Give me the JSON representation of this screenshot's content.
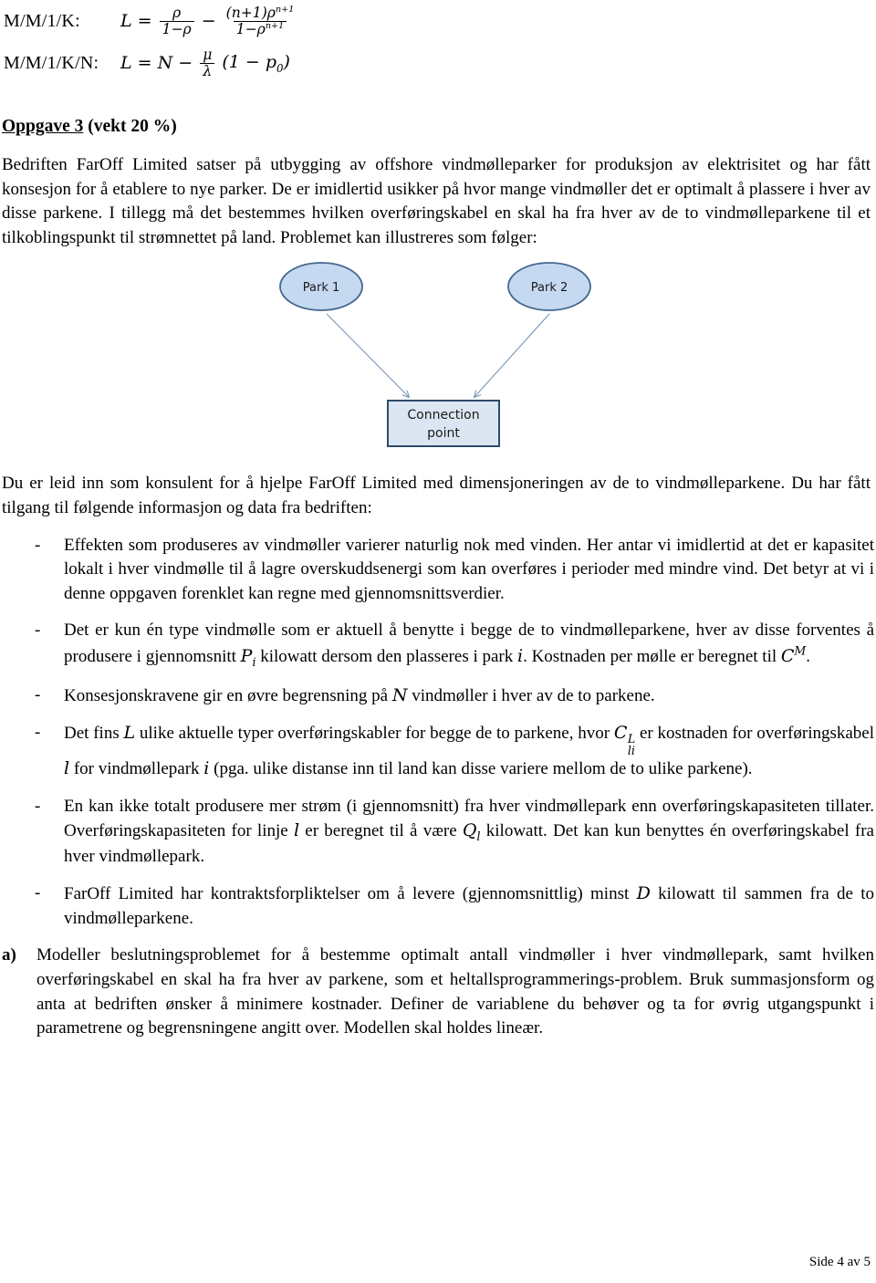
{
  "formulas": [
    {
      "label": "M/M/1/K:",
      "lhs": "L =",
      "term1_num": "ρ",
      "term1_den": "1−ρ",
      "operator": "−",
      "term2_num_a": "(n+1)ρ",
      "term2_num_sup": "n+1",
      "term2_den_a": "1−ρ",
      "term2_den_sup": "n+1"
    },
    {
      "label": "M/M/1/K/N:",
      "lhs": "L = N −",
      "frac_num": "μ",
      "frac_den": "λ",
      "tail_open": "(1 − p",
      "tail_sub": "0",
      "tail_close": ")"
    }
  ],
  "heading": {
    "title": "Oppgave 3",
    "weight": " (vekt 20 %)"
  },
  "intro_paragraph": "Bedriften FarOff Limited satser på utbygging av offshore vindmølleparker for produksjon av elektrisitet og har fått konsesjon for å etablere to nye parker. De er imidlertid usikker på hvor mange vindmøller det er optimalt å plassere i hver av disse parkene. I tillegg må det bestemmes hvilken overføringskabel en skal ha fra hver av de to vindmølleparkene til et tilkoblingspunkt til strømnettet på land. Problemet kan illustreres som følger:",
  "diagram": {
    "node_park1": "Park 1",
    "node_park2": "Park 2",
    "node_connection_line1": "Connection",
    "node_connection_line2": "point",
    "fill_color": "#c5d9f1",
    "stroke_color": "#44688f",
    "arrow_color": "#7795b5"
  },
  "consultant_paragraph": "Du er leid inn som konsulent for å hjelpe FarOff Limited med dimensjoneringen av de to vindmølleparkene. Du har fått tilgang til følgende informasjon og data fra bedriften:",
  "bullets": {
    "dash": "-",
    "items": [
      {
        "id": "effekt",
        "text": "Effekten som produseres av vindmøller varierer naturlig nok med vinden. Her antar vi imidlertid at det er kapasitet lokalt i hver vindmølle til å lagre overskuddsenergi som kan overføres i perioder med mindre vind. Det betyr at vi i denne oppgaven forenklet kan regne med gjennomsnittsverdier."
      },
      {
        "id": "molletype",
        "parts": [
          {
            "kind": "text",
            "value": "Det er kun én type vindmølle som er aktuell å benytte i begge de to vindmølleparkene, hver av disse forventes å produsere i gjennomsnitt "
          },
          {
            "kind": "math",
            "base": "P",
            "sub": "i"
          },
          {
            "kind": "text",
            "value": " kilowatt dersom den plasseres i park "
          },
          {
            "kind": "math",
            "base": "i"
          },
          {
            "kind": "text",
            "value": ". Kostnaden per mølle er beregnet til "
          },
          {
            "kind": "math",
            "base": "C",
            "sup": "M"
          },
          {
            "kind": "text",
            "value": "."
          }
        ]
      },
      {
        "id": "konsesjon",
        "parts": [
          {
            "kind": "text",
            "value": "Konsesjonskravene gir en øvre begrensning på "
          },
          {
            "kind": "math",
            "base": "N"
          },
          {
            "kind": "text",
            "value": " vindmøller i hver av de to parkene."
          }
        ]
      },
      {
        "id": "kabler",
        "parts": [
          {
            "kind": "text",
            "value": "Det fins "
          },
          {
            "kind": "math",
            "base": "L"
          },
          {
            "kind": "text",
            "value": " ulike aktuelle typer overføringskabler for begge de to parkene, hvor "
          },
          {
            "kind": "math",
            "base": "C",
            "sup": "L",
            "sub": "li"
          },
          {
            "kind": "text",
            "value": " er kostnaden for overføringskabel "
          },
          {
            "kind": "math",
            "base": "l"
          },
          {
            "kind": "text",
            "value": " for vindmøllepark "
          },
          {
            "kind": "math",
            "base": "i"
          },
          {
            "kind": "text",
            "value": " (pga. ulike distanse inn til land kan disse variere mellom de to ulike parkene)."
          }
        ]
      },
      {
        "id": "kapasitet",
        "parts": [
          {
            "kind": "text",
            "value": "En kan ikke totalt produsere mer strøm (i gjennomsnitt) fra hver vindmøllepark enn overføringskapasiteten tillater. Overføringskapasiteten for linje "
          },
          {
            "kind": "math",
            "base": "l"
          },
          {
            "kind": "text",
            "value": " er beregnet til å være "
          },
          {
            "kind": "math",
            "base": "Q",
            "sub": "l"
          },
          {
            "kind": "text",
            "value": " kilowatt. Det kan kun benyttes én overføringskabel fra hver vindmøllepark."
          }
        ]
      },
      {
        "id": "kontrakt",
        "parts": [
          {
            "kind": "text",
            "value": "FarOff Limited har kontraktsforpliktelser om å levere (gjennomsnittlig) minst "
          },
          {
            "kind": "math",
            "base": "D"
          },
          {
            "kind": "text",
            "value": " kilowatt til sammen fra de to vindmølleparkene."
          }
        ]
      }
    ]
  },
  "task_a": {
    "marker": "a)",
    "text": "Modeller beslutningsproblemet for å bestemme optimalt antall vindmøller i hver vindmøllepark, samt hvilken overføringskabel en skal ha fra hver av parkene, som et heltallsprogrammerings-problem. Bruk summasjonsform og anta at bedriften ønsker å minimere kostnader. Definer de variablene du behøver og ta for øvrig utgangspunkt i parametrene og begrensningene angitt over. Modellen skal holdes lineær."
  },
  "footer": {
    "page_label": "Side 4 av 5"
  }
}
